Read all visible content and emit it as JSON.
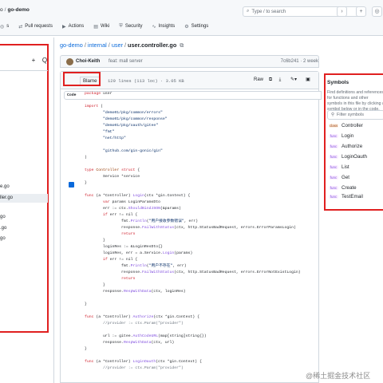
{
  "header": {
    "owner": "o",
    "repo": "go-demo",
    "search_placeholder": "Type / to search",
    "search_shortcut": "/",
    "nav": [
      {
        "icon": "issues-icon",
        "label": "s"
      },
      {
        "icon": "pull-request-icon",
        "label": "Pull requests"
      },
      {
        "icon": "actions-icon",
        "label": "Actions"
      },
      {
        "icon": "wiki-icon",
        "label": "Wiki"
      },
      {
        "icon": "security-icon",
        "label": "Security"
      },
      {
        "icon": "insights-icon",
        "label": "Insights"
      },
      {
        "icon": "settings-icon",
        "label": "Settings"
      }
    ]
  },
  "sidebar": {
    "add_label": "+",
    "search_label": "Q",
    "items": [
      "e.go",
      "ller.go",
      "go",
      ".go",
      "go"
    ]
  },
  "breadcrumb": {
    "repo": "go-demo",
    "parts": [
      "internal",
      "user"
    ],
    "file": "user.controller.go"
  },
  "commit": {
    "author": "Choi-Keith",
    "message": "feat: mall server",
    "hash": "7c6b241 · 2 week"
  },
  "file": {
    "tab_code": "Code",
    "tab_blame": "Blame",
    "meta": "129 lines (113 loc) · 3.05 KB",
    "raw_label": "Raw"
  },
  "code_lines": [
    {
      "html": "<span class='kw'>package</span> user"
    },
    {
      "html": ""
    },
    {
      "html": "<span class='kw'>import</span> ("
    },
    {
      "html": "        <span class='str'>\"demo01/pkg/common/errors\"</span>"
    },
    {
      "html": "        <span class='str'>\"demo01/pkg/common/response\"</span>"
    },
    {
      "html": "        <span class='str'>\"demo01/pkg/oauth/gitee\"</span>"
    },
    {
      "html": "        <span class='str'>\"fmt\"</span>"
    },
    {
      "html": "        <span class='str'>\"net/http\"</span>"
    },
    {
      "html": ""
    },
    {
      "html": "        <span class='str'>\"github.com/gin-gonic/gin\"</span>"
    },
    {
      "html": ")"
    },
    {
      "html": ""
    },
    {
      "html": "<span class='kw'>type</span> <span class='ty'>Controller</span> <span class='kw'>struct</span> {"
    },
    {
      "html": "        Service *service"
    },
    {
      "html": "}"
    },
    {
      "html": ""
    },
    {
      "html": "<span class='kw'>func</span> (a *Controller) <span class='fn'>Login</span>(ctx *gin.Context) {"
    },
    {
      "html": "        <span class='kw'>var</span> params LoginParamsDto"
    },
    {
      "html": "        err := ctx.<span class='fn'>ShouldBindJSON</span>(&amp;params)"
    },
    {
      "html": "        <span class='kw'>if</span> err != nil {"
    },
    {
      "html": "                fmt.<span class='fn'>Println</span>(<span class='str'>\"用户接收参数错误\"</span>, err)"
    },
    {
      "html": "                response.<span class='fn'>FailWithStatus</span>(ctx, http.StatusBadRequest, errors.ErrorParamsLogin)"
    },
    {
      "html": "                <span class='kw'>return</span>"
    },
    {
      "html": "        }"
    },
    {
      "html": "        loginRes := &amp;LoginResDto{}"
    },
    {
      "html": "        loginRes, err = a.Service.<span class='fn'>Login</span>(params)"
    },
    {
      "html": "        <span class='kw'>if</span> err != nil {"
    },
    {
      "html": "                fmt.<span class='fn'>Println</span>(<span class='str'>\"用户不存在\"</span>, err)"
    },
    {
      "html": "                response.<span class='fn'>FailWithStatus</span>(ctx, http.StatusBadRequest, errors.ErrorNotExistLogin)"
    },
    {
      "html": "                <span class='kw'>return</span>"
    },
    {
      "html": "        }"
    },
    {
      "html": "        response.<span class='fn'>RespWithData</span>(ctx, loginRes)"
    },
    {
      "html": ""
    },
    {
      "html": "}"
    },
    {
      "html": ""
    },
    {
      "html": "<span class='kw'>func</span> (a *Controller) <span class='fn'>Authorize</span>(ctx *gin.Context) {"
    },
    {
      "html": "        <span class='cm'>//provider := ctx.Param(\"provider\")</span>"
    },
    {
      "html": ""
    },
    {
      "html": "        url := gitee.<span class='fn'>AuthCodeURL</span>(map[string]string{})"
    },
    {
      "html": "        response.<span class='fn'>RespWithData</span>(ctx, url)"
    },
    {
      "html": "}"
    },
    {
      "html": ""
    },
    {
      "html": "<span class='kw'>func</span> (a *Controller) <span class='fn'>LoginOauth</span>(ctx *gin.Context) {"
    },
    {
      "html": "        <span class='cm'>//provider := ctx.Param(\"provider\")</span>"
    }
  ],
  "symbols": {
    "title": "Symbols",
    "description": "Find definitions and references for functions and other symbols in this file by clicking a symbol below or in the code.",
    "filter_placeholder": "Filter symbols",
    "items": [
      {
        "kind": "class",
        "name": "Controller"
      },
      {
        "kind": "func",
        "name": "Login"
      },
      {
        "kind": "func",
        "name": "Authorize"
      },
      {
        "kind": "func",
        "name": "LoginOauth"
      },
      {
        "kind": "func",
        "name": "List"
      },
      {
        "kind": "func",
        "name": "Get"
      },
      {
        "kind": "func",
        "name": "Create"
      },
      {
        "kind": "func",
        "name": "TestEmail"
      }
    ]
  },
  "watermark": "@稀土掘金技术社区"
}
